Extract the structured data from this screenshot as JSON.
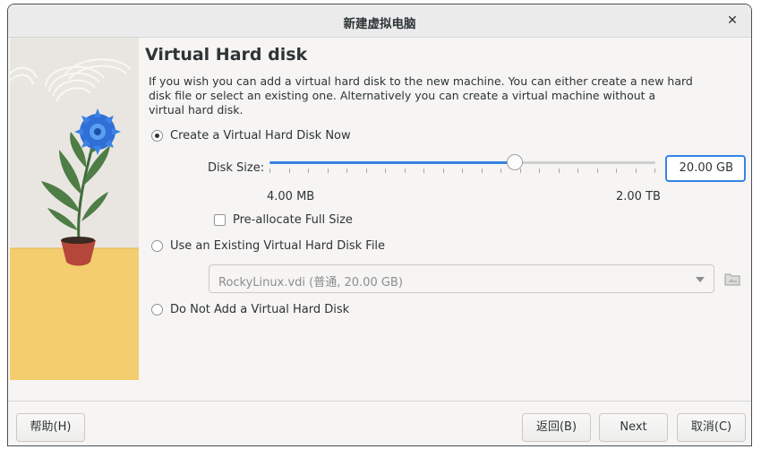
{
  "window": {
    "title": "新建虚拟电脑"
  },
  "page": {
    "heading": "Virtual Hard disk",
    "description": "If you wish you can add a virtual hard disk to the new machine. You can either create a new hard disk file or select an existing one. Alternatively you can create a virtual machine without a virtual hard disk."
  },
  "options": {
    "create_new": {
      "label": "Create a Virtual Hard Disk Now",
      "checked": true
    },
    "use_existing": {
      "label": "Use an Existing Virtual Hard Disk File",
      "checked": false
    },
    "none": {
      "label": "Do Not Add a Virtual Hard Disk",
      "checked": false
    }
  },
  "disk_size": {
    "label": "Disk Size:",
    "min_label": "4.00 MB",
    "max_label": "2.00 TB",
    "value": "20.00 GB",
    "slider_fraction": 0.635
  },
  "preallocate": {
    "label": "Pre-allocate Full Size",
    "checked": false
  },
  "existing_file": {
    "selected": "RockyLinux.vdi (普通, 20.00 GB)"
  },
  "icons": {
    "close": "close-icon",
    "folder": "folder-icon",
    "dropdown": "chevron-down-icon"
  },
  "buttons": {
    "help": "帮助(H)",
    "back": "返回(B)",
    "next": "Next",
    "cancel": "取消(C)"
  },
  "colors": {
    "accent": "#3584e4",
    "illustration_floor": "#f3cd6e"
  }
}
